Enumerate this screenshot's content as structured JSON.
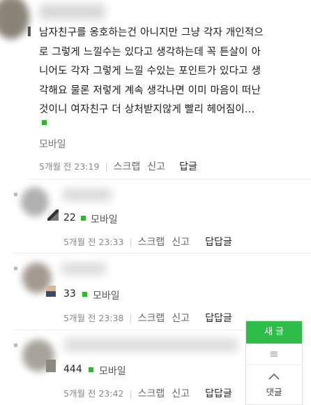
{
  "main_comment": {
    "lines": [
      "남자친구를 옹호하는건 아니지만 그냥 각자 개인적으",
      "로 그렇게 느낄수는 있다고 생각하는데 꼭 튼살이 아",
      "니어도 각자 그렇게 느낄 수있는 포인트가 있다고 생",
      "각해요 물론 저렇게 계속 생각나면 이미 마음이 떠난",
      "것이니 여자친구 더 상처받지않게 빨리 헤어짐이..."
    ],
    "source": "모바일",
    "time": "5개월 전 23:19",
    "scrap": "스크랩",
    "report": "신고",
    "reply": "답글"
  },
  "replies": [
    {
      "text": "22",
      "source": "모바일",
      "time": "5개월 전 23:33",
      "scrap": "스크랩",
      "report": "신고",
      "reply": "답답글"
    },
    {
      "text": "33",
      "source": "모바일",
      "time": "5개월 전 23:38",
      "scrap": "스크랩",
      "report": "신고",
      "reply": "답답글"
    },
    {
      "text": "444",
      "source": "모바일",
      "time": "5개월 전 23:42",
      "scrap": "스크랩",
      "report": "신고",
      "reply": "답답글"
    }
  ],
  "floating_nav": {
    "new_post": "새 글",
    "menu_icon": "≡",
    "comments_label": "댓글"
  },
  "colors": {
    "accent_green": "#2fbd49"
  }
}
